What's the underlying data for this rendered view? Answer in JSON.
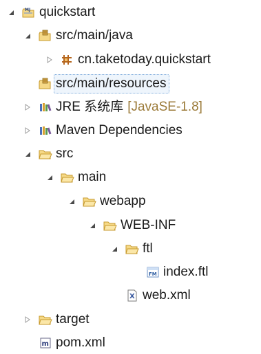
{
  "tree": {
    "project": "quickstart",
    "src_main_java": "src/main/java",
    "package": "cn.taketoday.quickstart",
    "src_main_resources": "src/main/resources",
    "jre_label": "JRE 系统库",
    "jre_decor": "[JavaSE-1.8]",
    "maven_deps": "Maven Dependencies",
    "src": "src",
    "main": "main",
    "webapp": "webapp",
    "web_inf": "WEB-INF",
    "ftl": "ftl",
    "index_ftl": "index.ftl",
    "web_xml": "web.xml",
    "target": "target",
    "pom_xml": "pom.xml"
  },
  "icons": {
    "project": "java-project-icon",
    "source_folder": "source-folder-icon",
    "package": "package-icon",
    "library": "library-icon",
    "folder": "folder-icon",
    "ftl_file": "ftl-file-icon",
    "xml_file": "xml-file-icon",
    "maven_file": "maven-pom-icon"
  },
  "colors": {
    "folder_fill": "#f6d987",
    "folder_stroke": "#c79a2e",
    "selection_border": "#7aa8da",
    "decor_text": "#9b7a38"
  }
}
